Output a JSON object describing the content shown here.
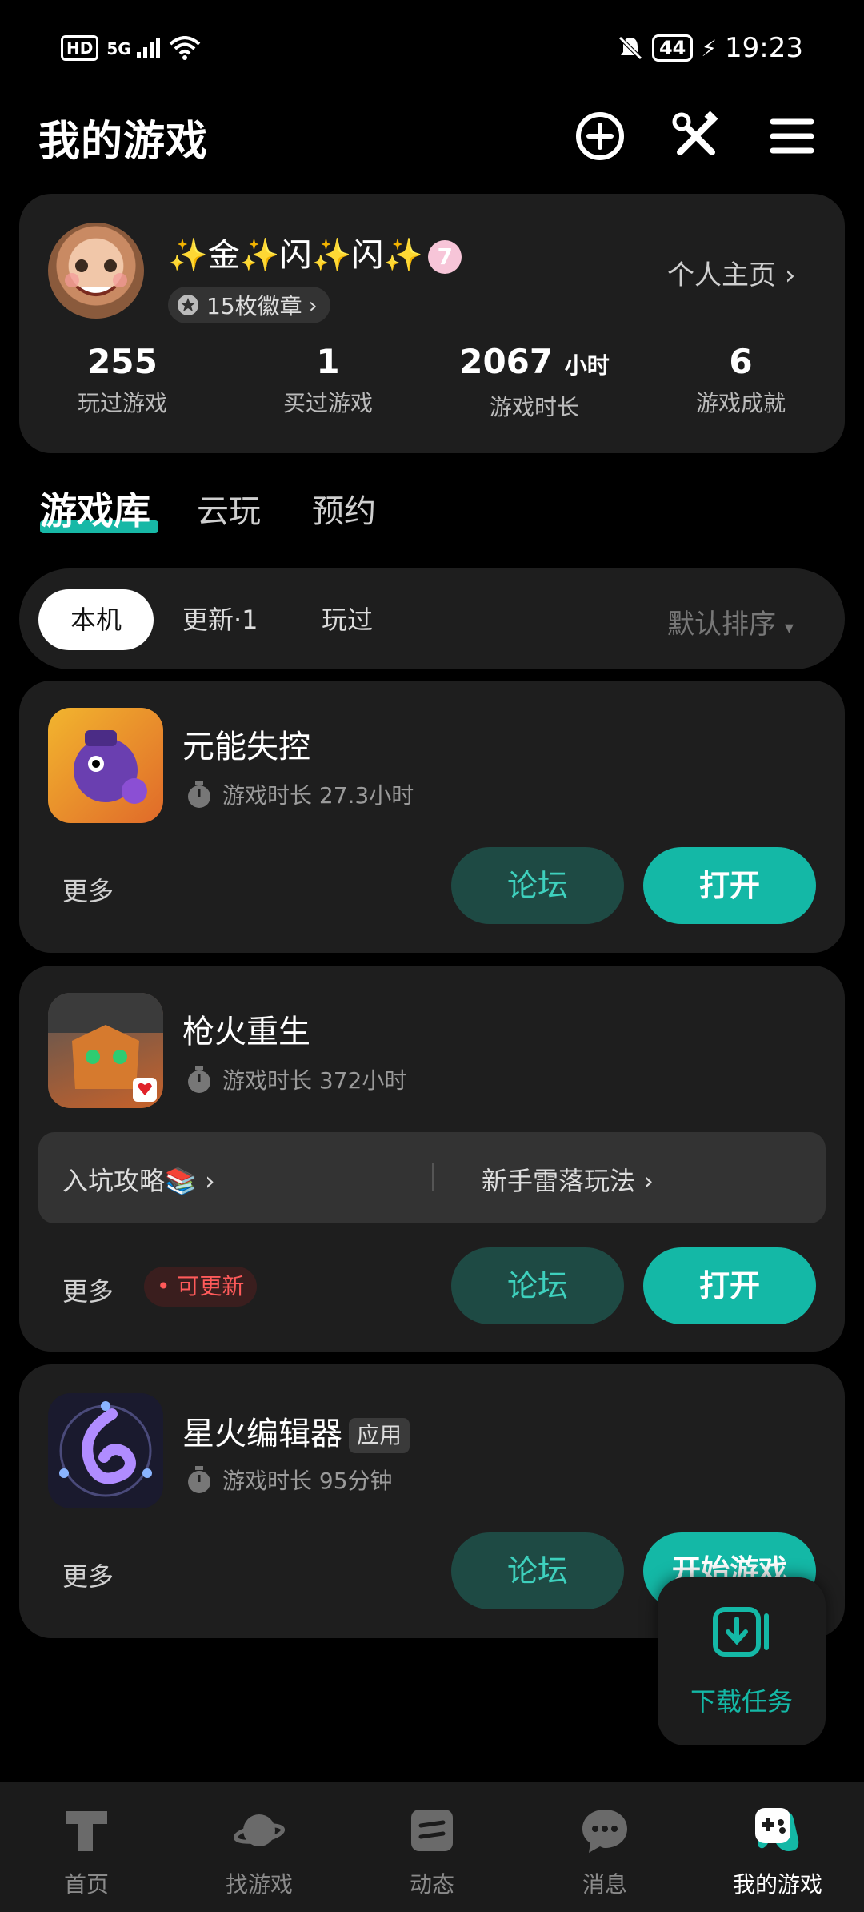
{
  "status_bar": {
    "hd": "HD",
    "signal": "5G",
    "battery": "44",
    "time": "19:23"
  },
  "header": {
    "title": "我的游戏"
  },
  "profile": {
    "nickname": "✨金✨闪✨闪✨",
    "level": "7",
    "medals": "15枚徽章",
    "homepage": "个人主页",
    "stats": [
      {
        "value": "255",
        "unit": "",
        "label": "玩过游戏"
      },
      {
        "value": "1",
        "unit": "",
        "label": "买过游戏"
      },
      {
        "value": "2067",
        "unit": "小时",
        "label": "游戏时长"
      },
      {
        "value": "6",
        "unit": "",
        "label": "游戏成就"
      }
    ]
  },
  "tabs": [
    "游戏库",
    "云玩",
    "预约"
  ],
  "filters": {
    "chips": [
      "本机",
      "更新·1",
      "玩过"
    ],
    "sort": "默认排序"
  },
  "games": [
    {
      "name": "元能失控",
      "tag": "",
      "playtime": "游戏时长 27.3小时",
      "more": "更多",
      "forum": "论坛",
      "open": "打开"
    },
    {
      "name": "枪火重生",
      "tag": "",
      "playtime": "游戏时长 372小时",
      "guides": [
        "入坑攻略📚",
        "新手雷落玩法"
      ],
      "update": "可更新",
      "more": "更多",
      "forum": "论坛",
      "open": "打开"
    },
    {
      "name": "星火编辑器",
      "tag": "应用",
      "playtime": "游戏时长 95分钟",
      "more": "更多",
      "forum": "论坛",
      "open": "开始游戏"
    }
  ],
  "download": {
    "label": "下载任务"
  },
  "bottom_nav": [
    {
      "label": "首页"
    },
    {
      "label": "找游戏"
    },
    {
      "label": "动态"
    },
    {
      "label": "消息"
    },
    {
      "label": "我的游戏"
    }
  ],
  "colors": {
    "accent": "#14b8a6",
    "card": "#1e1e1e",
    "forum_bg": "#1e4a44",
    "update": "#ff5a5a"
  }
}
